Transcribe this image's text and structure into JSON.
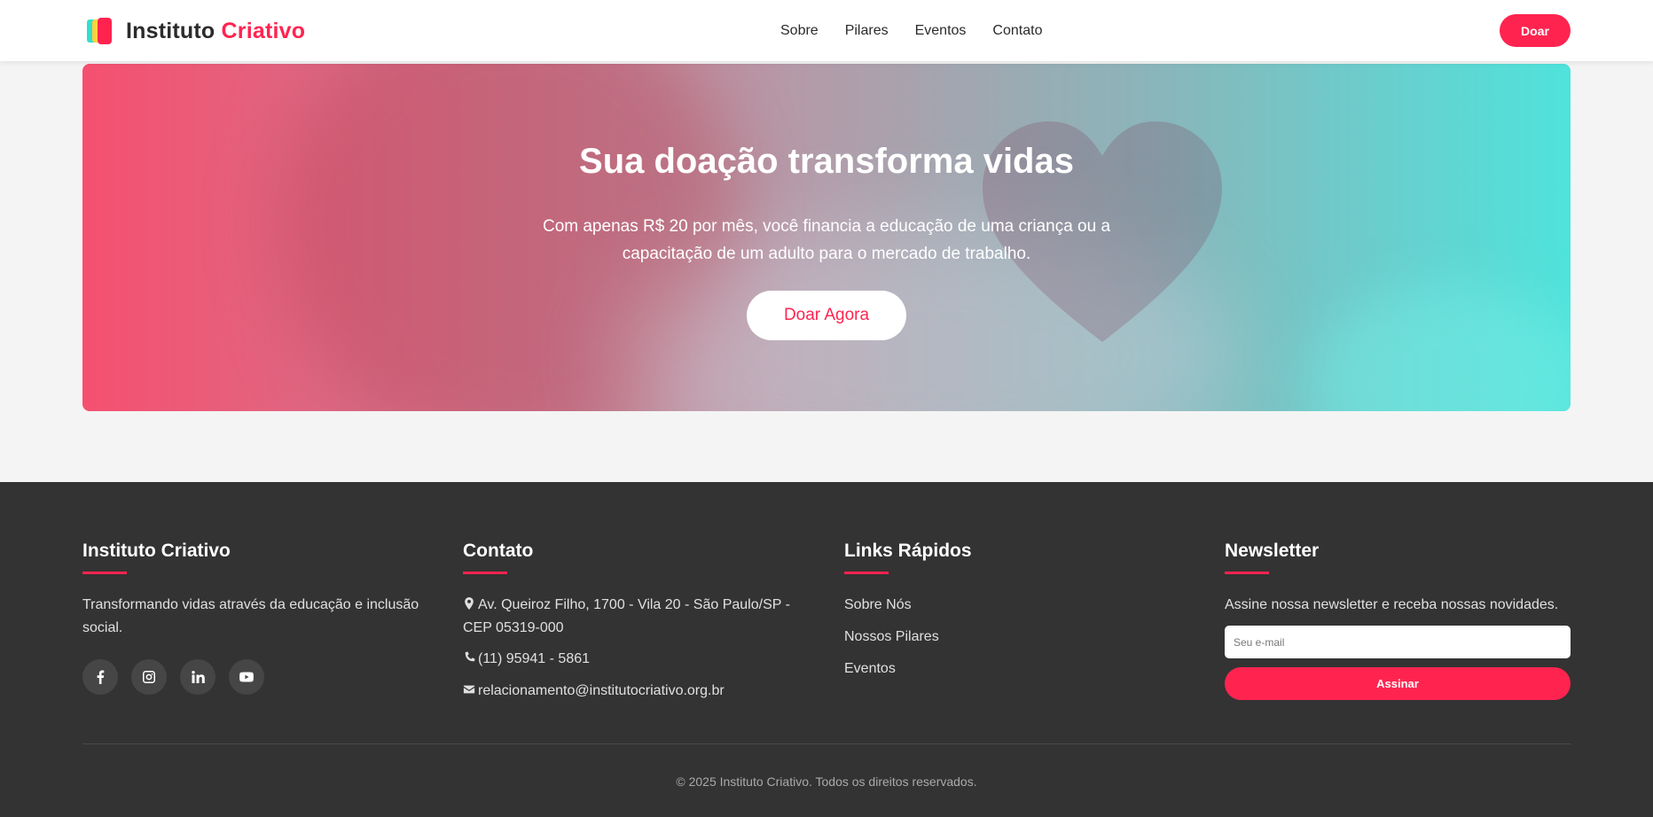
{
  "header": {
    "logo_text_part1": "Instituto",
    "logo_text_part2": "Criativo",
    "nav": [
      "Sobre",
      "Pilares",
      "Eventos",
      "Contato"
    ],
    "cta_label": "Doar"
  },
  "hero": {
    "title": "Sua doação transforma vidas",
    "subtitle": "Com apenas R$ 20 por mês, você financia a educação de uma criança ou a capacitação de um adulto para o mercado de trabalho.",
    "button_label": "Doar Agora"
  },
  "footer": {
    "about": {
      "title": "Instituto Criativo",
      "text": "Transformando vidas através da educação e inclusão social.",
      "socials": [
        "facebook-icon",
        "instagram-icon",
        "linkedin-icon",
        "youtube-icon"
      ]
    },
    "contact": {
      "title": "Contato",
      "address": "Av. Queiroz Filho, 1700 - Vila 20 - São Paulo/SP - CEP 05319-000",
      "phone": "(11) 95941 - 5861",
      "email": "relacionamento@institutocriativo.org.br"
    },
    "links": {
      "title": "Links Rápidos",
      "items": [
        "Sobre Nós",
        "Nossos Pilares",
        "Eventos"
      ]
    },
    "newsletter": {
      "title": "Newsletter",
      "text": "Assine nossa newsletter e receba nossas novidades.",
      "placeholder": "Seu e-mail",
      "button_label": "Assinar"
    },
    "copyright": "© 2025 Instituto Criativo. Todos os direitos reservados."
  },
  "colors": {
    "accent": "#ff2450",
    "footer_bg": "#333333",
    "page_bg": "#f4f4f4"
  }
}
